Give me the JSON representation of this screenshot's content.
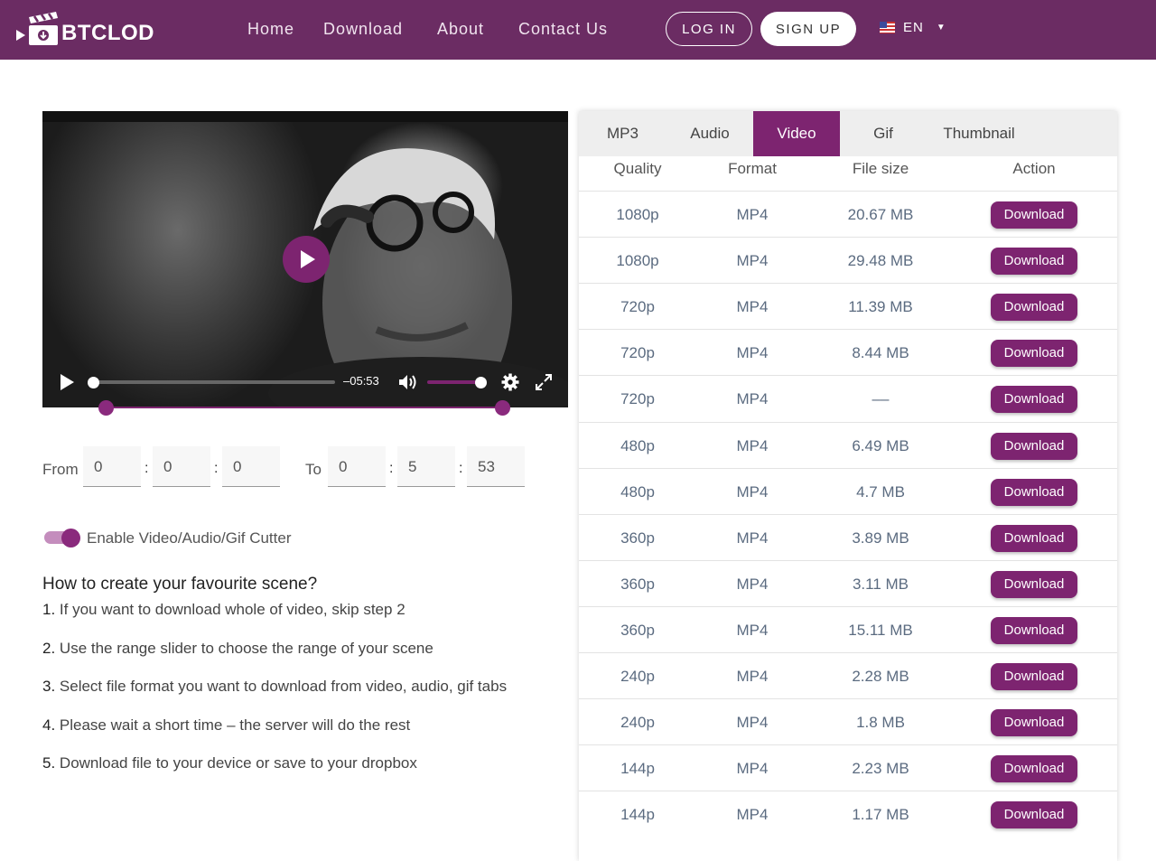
{
  "header": {
    "logo_text": "BTCLOD",
    "nav": [
      "Home",
      "Download",
      "About",
      "Contact Us"
    ],
    "login": "LOG IN",
    "signup": "SIGN UP",
    "language": "EN"
  },
  "player": {
    "time_remaining": "–05:53",
    "progress_fraction": 0.0,
    "volume_fraction": 1.0
  },
  "cutter": {
    "from_label": "From",
    "to_label": "To",
    "from": [
      "0",
      "0",
      "0"
    ],
    "to": [
      "0",
      "5",
      "53"
    ],
    "toggle_label": "Enable Video/Audio/Gif Cutter",
    "toggle_on": true
  },
  "howto": {
    "title": "How to create your favourite scene?",
    "steps": [
      {
        "num": "1.",
        "text": " If you want to download whole of video, skip step 2"
      },
      {
        "num": "2.",
        "text": " Use the range slider to choose the range of your scene"
      },
      {
        "num": "3.",
        "text": " Select file format you want to download from video, audio, gif tabs"
      },
      {
        "num": "4.",
        "text": " Please wait a short time – the server will do the rest"
      },
      {
        "num": "5.",
        "text": " Download file to your device or save to your dropbox"
      }
    ]
  },
  "panel": {
    "tabs": [
      "MP3",
      "Audio",
      "Video",
      "Gif",
      "Thumbnail"
    ],
    "active_tab": "Video",
    "columns": [
      "Quality",
      "Format",
      "File size",
      "Action"
    ],
    "rows": [
      {
        "quality": "1080p",
        "format": "MP4",
        "size": "20.67 MB",
        "action": "Download"
      },
      {
        "quality": "1080p",
        "format": "MP4",
        "size": "29.48 MB",
        "action": "Download"
      },
      {
        "quality": "720p",
        "format": "MP4",
        "size": "11.39 MB",
        "action": "Download"
      },
      {
        "quality": "720p",
        "format": "MP4",
        "size": "8.44 MB",
        "action": "Download"
      },
      {
        "quality": "720p",
        "format": "MP4",
        "size": "––",
        "action": "Download"
      },
      {
        "quality": "480p",
        "format": "MP4",
        "size": "6.49 MB",
        "action": "Download"
      },
      {
        "quality": "480p",
        "format": "MP4",
        "size": "4.7 MB",
        "action": "Download"
      },
      {
        "quality": "360p",
        "format": "MP4",
        "size": "3.89 MB",
        "action": "Download"
      },
      {
        "quality": "360p",
        "format": "MP4",
        "size": "3.11 MB",
        "action": "Download"
      },
      {
        "quality": "360p",
        "format": "MP4",
        "size": "15.11 MB",
        "action": "Download"
      },
      {
        "quality": "240p",
        "format": "MP4",
        "size": "2.28 MB",
        "action": "Download"
      },
      {
        "quality": "240p",
        "format": "MP4",
        "size": "1.8 MB",
        "action": "Download"
      },
      {
        "quality": "144p",
        "format": "MP4",
        "size": "2.23 MB",
        "action": "Download"
      },
      {
        "quality": "144p",
        "format": "MP4",
        "size": "1.17 MB",
        "action": "Download"
      }
    ]
  },
  "colors": {
    "brand": "#6b2c63",
    "accent": "#7d2470"
  },
  "icons": [
    "clapperboard-icon",
    "flag-us-icon",
    "chevron-down-icon",
    "play-icon",
    "volume-icon",
    "gear-icon",
    "fullscreen-icon"
  ]
}
